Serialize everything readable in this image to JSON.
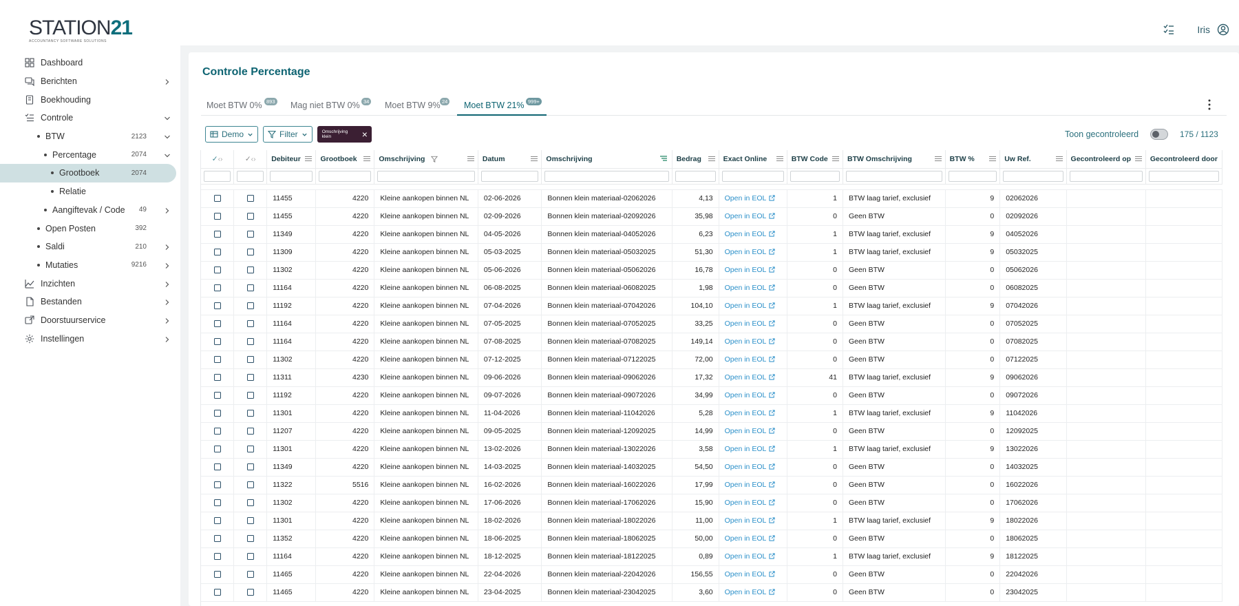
{
  "app": {
    "logo_main": "STATION",
    "logo_num": "21",
    "logo_sub": "ACCOUNTANCY SOFTWARE SOLUTIONS"
  },
  "topbar": {
    "user_name": "Iris"
  },
  "sidebar": {
    "items": [
      {
        "label": "Dashboard",
        "icon": "dashboard-icon",
        "level": 0,
        "chevron": ""
      },
      {
        "label": "Berichten",
        "icon": "messages-icon",
        "level": 0,
        "chevron": "right"
      },
      {
        "label": "Boekhouding",
        "icon": "book-icon",
        "level": 0,
        "chevron": ""
      },
      {
        "label": "Controle",
        "icon": "checklist-icon",
        "level": 0,
        "chevron": "down"
      },
      {
        "label": "BTW",
        "level": 1,
        "count": "2123",
        "chevron": "down"
      },
      {
        "label": "Percentage",
        "level": 2,
        "count": "2074",
        "chevron": "down"
      },
      {
        "label": "Grootboek",
        "level": 3,
        "count": "2074",
        "chevron": "",
        "active": true
      },
      {
        "label": "Relatie",
        "level": 3,
        "count": "",
        "chevron": ""
      },
      {
        "label": "Aangiftevak / Code",
        "level": 2,
        "count": "49",
        "chevron": "right"
      },
      {
        "label": "Open Posten",
        "level": 1,
        "count": "392",
        "chevron": ""
      },
      {
        "label": "Saldi",
        "level": 1,
        "count": "210",
        "chevron": "right"
      },
      {
        "label": "Mutaties",
        "level": 1,
        "count": "9216",
        "chevron": "right"
      },
      {
        "label": "Inzichten",
        "icon": "insights-icon",
        "level": 0,
        "chevron": "right"
      },
      {
        "label": "Bestanden",
        "icon": "files-icon",
        "level": 0,
        "chevron": "right"
      },
      {
        "label": "Doorstuurservice",
        "icon": "forward-icon",
        "level": 0,
        "chevron": "right"
      },
      {
        "label": "Instellingen",
        "icon": "gear-icon",
        "level": 0,
        "chevron": "right"
      }
    ]
  },
  "main": {
    "title": "Controle Percentage",
    "tabs": [
      {
        "label": "Moet BTW 0%",
        "badge": "893"
      },
      {
        "label": "Mag niet BTW 0%",
        "badge": "34"
      },
      {
        "label": "Moet BTW 9%",
        "badge": "24"
      },
      {
        "label": "Moet BTW 21%",
        "badge": "999+",
        "active": true
      }
    ],
    "toolbar": {
      "demo_label": "Demo",
      "filter_label": "Filter",
      "chip_label": "Omschrijving klein",
      "toon_label": "Toon gecontroleerd",
      "counter": "175 / 1123"
    }
  },
  "table": {
    "columns": [
      "",
      "",
      "Debiteur",
      "Grootboek",
      "Omschrijving",
      "Datum",
      "Omschrijving",
      "Bedrag",
      "Exact Online",
      "BTW Code",
      "BTW Omschrijving",
      "BTW %",
      "Uw Ref.",
      "Gecontroleerd op",
      "Gecontroleerd door"
    ],
    "link_text": "Open in EOL",
    "rows": [
      [
        "11455",
        "4220",
        "Kleine aankopen binnen NL",
        "02-06-2026",
        "Bonnen klein materiaal-02062026",
        "4,13",
        "1",
        "BTW laag tarief, exclusief",
        "9",
        "02062026"
      ],
      [
        "11455",
        "4220",
        "Kleine aankopen binnen NL",
        "02-09-2026",
        "Bonnen klein materiaal-02092026",
        "35,98",
        "0",
        "Geen BTW",
        "0",
        "02092026"
      ],
      [
        "11349",
        "4220",
        "Kleine aankopen binnen NL",
        "04-05-2026",
        "Bonnen klein materiaal-04052026",
        "6,23",
        "1",
        "BTW laag tarief, exclusief",
        "9",
        "04052026"
      ],
      [
        "11309",
        "4220",
        "Kleine aankopen binnen NL",
        "05-03-2025",
        "Bonnen klein materiaal-05032025",
        "51,30",
        "1",
        "BTW laag tarief, exclusief",
        "9",
        "05032025"
      ],
      [
        "11302",
        "4220",
        "Kleine aankopen binnen NL",
        "05-06-2026",
        "Bonnen klein materiaal-05062026",
        "16,78",
        "0",
        "Geen BTW",
        "0",
        "05062026"
      ],
      [
        "11164",
        "4220",
        "Kleine aankopen binnen NL",
        "06-08-2025",
        "Bonnen klein materiaal-06082025",
        "1,98",
        "0",
        "Geen BTW",
        "0",
        "06082025"
      ],
      [
        "11192",
        "4220",
        "Kleine aankopen binnen NL",
        "07-04-2026",
        "Bonnen klein materiaal-07042026",
        "104,10",
        "1",
        "BTW laag tarief, exclusief",
        "9",
        "07042026"
      ],
      [
        "11164",
        "4220",
        "Kleine aankopen binnen NL",
        "07-05-2025",
        "Bonnen klein materiaal-07052025",
        "33,25",
        "0",
        "Geen BTW",
        "0",
        "07052025"
      ],
      [
        "11164",
        "4220",
        "Kleine aankopen binnen NL",
        "07-08-2025",
        "Bonnen klein materiaal-07082025",
        "149,14",
        "0",
        "Geen BTW",
        "0",
        "07082025"
      ],
      [
        "11302",
        "4220",
        "Kleine aankopen binnen NL",
        "07-12-2025",
        "Bonnen klein materiaal-07122025",
        "72,00",
        "0",
        "Geen BTW",
        "0",
        "07122025"
      ],
      [
        "11311",
        "4230",
        "Kleine aankopen binnen NL",
        "09-06-2026",
        "Bonnen klein materiaal-09062026",
        "17,32",
        "41",
        "BTW laag tarief, exclusief",
        "9",
        "09062026"
      ],
      [
        "11192",
        "4220",
        "Kleine aankopen binnen NL",
        "09-07-2026",
        "Bonnen klein materiaal-09072026",
        "34,99",
        "0",
        "Geen BTW",
        "0",
        "09072026"
      ],
      [
        "11301",
        "4220",
        "Kleine aankopen binnen NL",
        "11-04-2026",
        "Bonnen klein materiaal-11042026",
        "5,28",
        "1",
        "BTW laag tarief, exclusief",
        "9",
        "11042026"
      ],
      [
        "11207",
        "4220",
        "Kleine aankopen binnen NL",
        "09-05-2025",
        "Bonnen klein materiaal-12092025",
        "14,99",
        "0",
        "Geen BTW",
        "0",
        "12092025"
      ],
      [
        "11301",
        "4220",
        "Kleine aankopen binnen NL",
        "13-02-2026",
        "Bonnen klein materiaal-13022026",
        "3,58",
        "1",
        "BTW laag tarief, exclusief",
        "9",
        "13022026"
      ],
      [
        "11349",
        "4220",
        "Kleine aankopen binnen NL",
        "14-03-2025",
        "Bonnen klein materiaal-14032025",
        "54,50",
        "0",
        "Geen BTW",
        "0",
        "14032025"
      ],
      [
        "11322",
        "5516",
        "Kleine aankopen binnen NL",
        "16-02-2026",
        "Bonnen klein materiaal-16022026",
        "17,99",
        "0",
        "Geen BTW",
        "0",
        "16022026"
      ],
      [
        "11302",
        "4220",
        "Kleine aankopen binnen NL",
        "17-06-2026",
        "Bonnen klein materiaal-17062026",
        "15,90",
        "0",
        "Geen BTW",
        "0",
        "17062026"
      ],
      [
        "11301",
        "4220",
        "Kleine aankopen binnen NL",
        "18-02-2026",
        "Bonnen klein materiaal-18022026",
        "11,00",
        "1",
        "BTW laag tarief, exclusief",
        "9",
        "18022026"
      ],
      [
        "11352",
        "4220",
        "Kleine aankopen binnen NL",
        "18-06-2025",
        "Bonnen klein materiaal-18062025",
        "50,00",
        "0",
        "Geen BTW",
        "0",
        "18062025"
      ],
      [
        "11164",
        "4220",
        "Kleine aankopen binnen NL",
        "18-12-2025",
        "Bonnen klein materiaal-18122025",
        "0,89",
        "1",
        "BTW laag tarief, exclusief",
        "9",
        "18122025"
      ],
      [
        "11465",
        "4220",
        "Kleine aankopen binnen NL",
        "22-04-2026",
        "Bonnen klein materiaal-22042026",
        "156,55",
        "0",
        "Geen BTW",
        "0",
        "22042026"
      ],
      [
        "11465",
        "4220",
        "Kleine aankopen binnen NL",
        "23-04-2025",
        "Bonnen klein materiaal-23042025",
        "3,60",
        "0",
        "Geen BTW",
        "0",
        "23042025"
      ]
    ]
  }
}
